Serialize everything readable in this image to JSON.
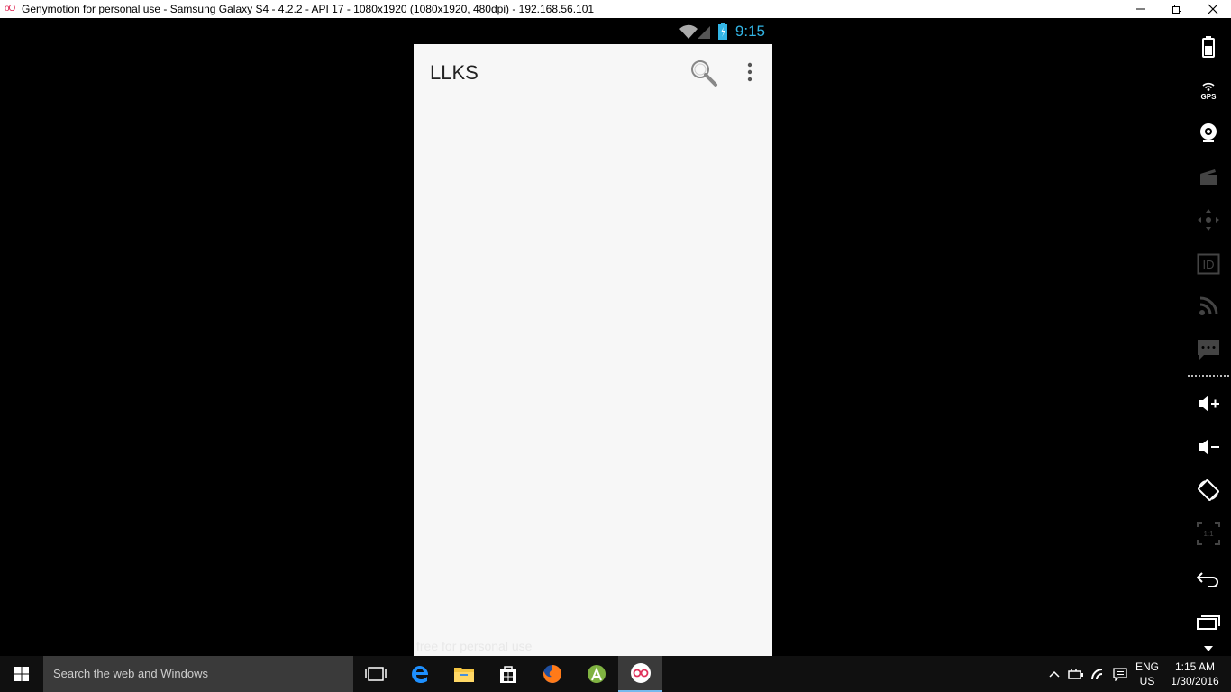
{
  "window": {
    "title": "Genymotion for personal use - Samsung Galaxy S4 - 4.2.2 - API 17 - 1080x1920 (1080x1920, 480dpi) - 192.168.56.101",
    "app_icon_text": "oO"
  },
  "android": {
    "status_time": "9:15",
    "app_title": "LLKS",
    "watermark": "free for personal use"
  },
  "toolbar": {
    "items": [
      "battery-icon",
      "gps-icon",
      "webcam-icon",
      "capture-icon",
      "remote-control-icon",
      "device-id-icon",
      "network-icon",
      "sms-icon",
      "volume-up-icon",
      "volume-down-icon",
      "rotate-icon",
      "pixel-perfect-icon",
      "back-icon",
      "recent-apps-icon"
    ],
    "gps_label": "GPS",
    "id_label": "ID",
    "pixel_label": "1:1"
  },
  "taskbar": {
    "search_placeholder": "Search the web and Windows",
    "apps": [
      "task-view-icon",
      "edge-icon",
      "file-explorer-icon",
      "store-icon",
      "firefox-icon",
      "android-studio-icon",
      "genymotion-icon"
    ],
    "lang_line1": "ENG",
    "lang_line2": "US",
    "time": "1:15 AM",
    "date": "1/30/2016"
  },
  "colors": {
    "status_time": "#33b5e5",
    "active_indicator": "#76b9ed",
    "genymotion_accent": "#e0305a"
  }
}
